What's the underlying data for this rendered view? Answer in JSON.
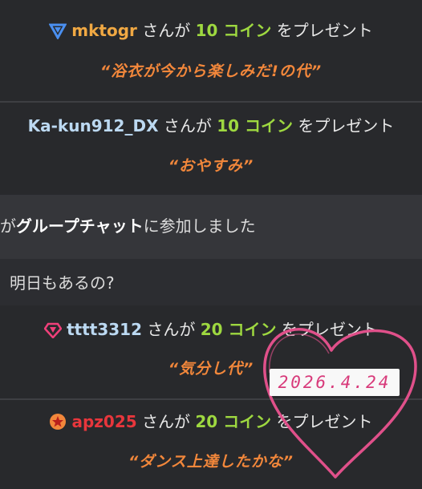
{
  "feed": {
    "gifts": [
      {
        "user": "mktogr",
        "user_color": "#f0a843",
        "icon": "blue-triangle-rank-icon",
        "sanga": "さんが",
        "coins": "10 コイン",
        "present": "をプレゼント",
        "message": "“浴衣が今から楽しみだ!の代”"
      },
      {
        "user": "Ka-kun912_DX",
        "user_color": "#bcd9f2",
        "icon": "",
        "sanga": "さんが",
        "coins": "10 コイン",
        "present": "をプレゼント",
        "message": "“おやすみ”"
      },
      {
        "user": "tttt3312",
        "user_color": "#bcd9f2",
        "icon": "pink-gem-rank-icon",
        "sanga": "さんが",
        "coins": "20 コイン",
        "present": "をプレゼント",
        "message": "“気分し代”"
      },
      {
        "user": "apz025",
        "user_color": "#e8363c",
        "icon": "orange-star-rank-icon",
        "sanga": "さんが",
        "coins": "20 コイン",
        "present": "をプレゼント",
        "message": "“ダンス上達したかな”"
      }
    ],
    "system_message": {
      "prefix": "が",
      "bold": "グループチャット",
      "suffix": "に参加しました"
    },
    "chat_message": "明日もあるの?"
  },
  "overlay": {
    "date_stamp": "2026.4.24",
    "heart_color": "#e0508a"
  }
}
